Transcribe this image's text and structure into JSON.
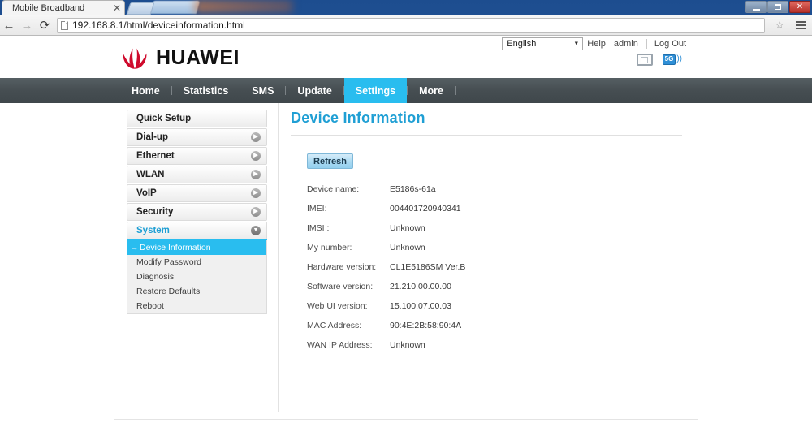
{
  "window": {
    "minimize_label": "minimize",
    "maximize_label": "maximize",
    "close_label": "✕"
  },
  "browser": {
    "tab_title": "Mobile Broadband",
    "tab_close": "✕",
    "back_icon": "←",
    "forward_icon": "→",
    "reload_icon": "⟳",
    "url": "192.168.8.1/html/deviceinformation.html",
    "star_icon": "☆"
  },
  "header": {
    "language": "English",
    "language_caret": "▼",
    "help_label": "Help",
    "user_label": "admin",
    "logout_label": "Log Out",
    "brand": "HUAWEI",
    "signal_badge": "5G",
    "signal_waves": "))"
  },
  "nav": {
    "items": [
      {
        "label": "Home",
        "active": false
      },
      {
        "label": "Statistics",
        "active": false
      },
      {
        "label": "SMS",
        "active": false
      },
      {
        "label": "Update",
        "active": false
      },
      {
        "label": "Settings",
        "active": true
      },
      {
        "label": "More",
        "active": false
      }
    ]
  },
  "sidebar": {
    "items": [
      {
        "label": "Quick Setup",
        "chevron": "",
        "open": false
      },
      {
        "label": "Dial-up",
        "chevron": "▶",
        "open": false
      },
      {
        "label": "Ethernet",
        "chevron": "▶",
        "open": false
      },
      {
        "label": "WLAN",
        "chevron": "▶",
        "open": false
      },
      {
        "label": "VoIP",
        "chevron": "▶",
        "open": false
      },
      {
        "label": "Security",
        "chevron": "▶",
        "open": false
      },
      {
        "label": "System",
        "chevron": "▼",
        "open": true
      }
    ],
    "submenu": [
      {
        "label": "Device Information",
        "active": true,
        "arrow": "→"
      },
      {
        "label": "Modify Password",
        "active": false,
        "arrow": ""
      },
      {
        "label": "Diagnosis",
        "active": false,
        "arrow": ""
      },
      {
        "label": "Restore Defaults",
        "active": false,
        "arrow": ""
      },
      {
        "label": "Reboot",
        "active": false,
        "arrow": ""
      }
    ]
  },
  "main": {
    "title": "Device Information",
    "refresh_label": "Refresh",
    "rows": [
      {
        "label": "Device name:",
        "value": "E5186s-61a"
      },
      {
        "label": "IMEI:",
        "value": "004401720940341"
      },
      {
        "label": "IMSI :",
        "value": "Unknown"
      },
      {
        "label": "My number:",
        "value": "Unknown"
      },
      {
        "label": "Hardware version:",
        "value": "CL1E5186SM Ver.B"
      },
      {
        "label": "Software version:",
        "value": "21.210.00.00.00"
      },
      {
        "label": "Web UI version:",
        "value": "15.100.07.00.03"
      },
      {
        "label": "MAC Address:",
        "value": "90:4E:2B:58:90:4A"
      },
      {
        "label": "WAN IP Address:",
        "value": "Unknown"
      }
    ]
  },
  "colors": {
    "accent": "#29bdef",
    "title": "#1f9fd4",
    "nav_bg": "#464e52",
    "brand_red": "#cf0a2c"
  }
}
